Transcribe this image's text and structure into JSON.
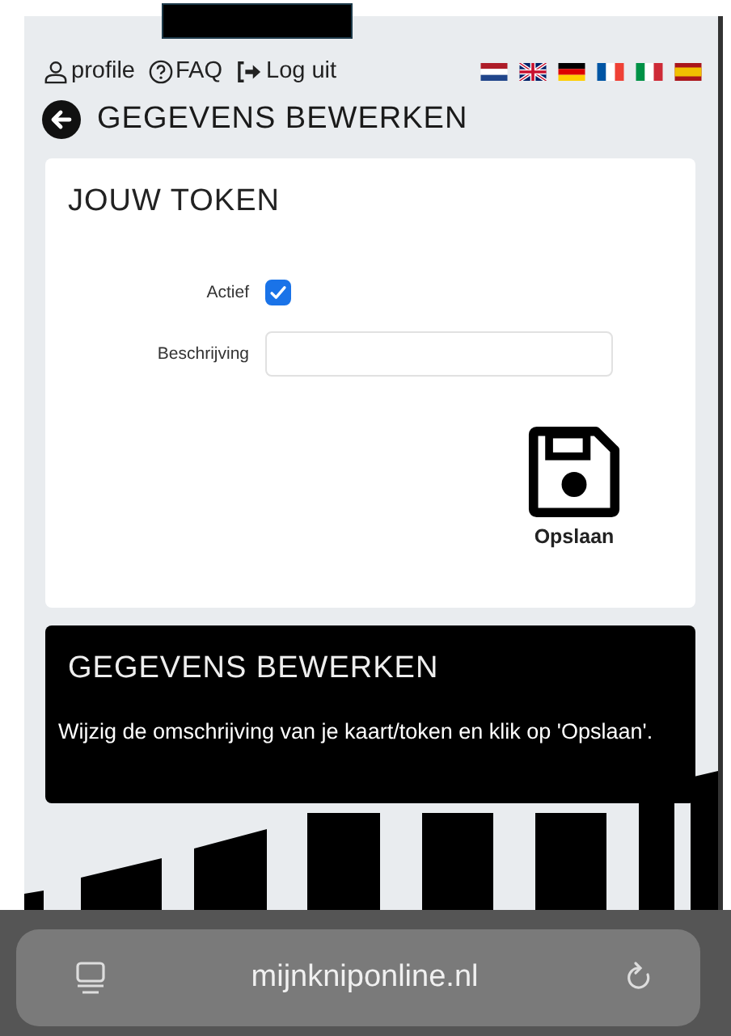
{
  "nav": {
    "links": [
      {
        "kind": "profile",
        "label": "profile"
      },
      {
        "kind": "faq",
        "label": "FAQ"
      },
      {
        "kind": "logout",
        "label": "Log uit"
      }
    ]
  },
  "page_title": "GEGEVENS BEWERKEN",
  "token_card": {
    "title": "JOUW TOKEN",
    "active": {
      "label": "Actief",
      "checked": true
    },
    "description": {
      "label": "Beschrijving"
    },
    "save_button": "Opslaan"
  },
  "info_card": {
    "title": "GEGEVENS BEWERKEN",
    "text": "Wijzig de omschrijving van je kaart/token en klik op 'Opslaan'."
  },
  "browser_bar": {
    "url": "mijnkniponline.nl"
  }
}
